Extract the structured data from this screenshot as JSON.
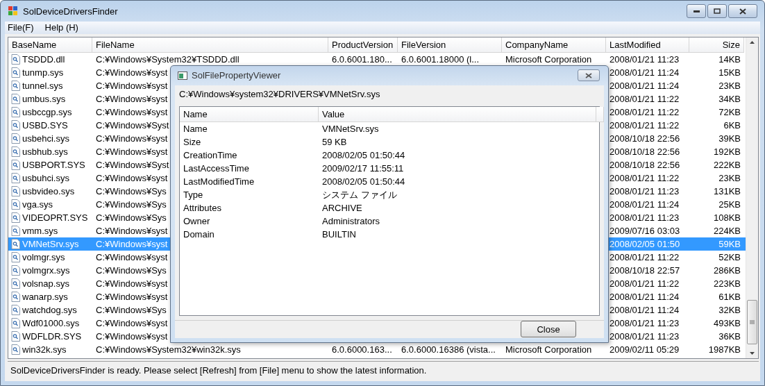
{
  "window": {
    "title": "SolDeviceDriversFinder"
  },
  "menu": [
    "File(F)",
    "Help (H)"
  ],
  "table": {
    "columns": [
      "BaseName",
      "FileName",
      "ProductVersion",
      "FileVersion",
      "CompanyName",
      "LastModified",
      "Size"
    ],
    "rows": [
      {
        "base_name": "TSDDD.dll",
        "file_name": "C:¥Windows¥System32¥TSDDD.dll",
        "product_version": "6.0.6001.180...",
        "file_version": "6.0.6001.18000 (l...",
        "company_name": "Microsoft Corporation",
        "last_modified": "2008/01/21 11:23",
        "size": "14KB",
        "selected": false
      },
      {
        "base_name": "tunmp.sys",
        "file_name": "C:¥Windows¥syst",
        "last_modified": "2008/01/21 11:24",
        "size": "15KB",
        "selected": false
      },
      {
        "base_name": "tunnel.sys",
        "file_name": "C:¥Windows¥syst",
        "last_modified": "2008/01/21 11:24",
        "size": "23KB",
        "selected": false
      },
      {
        "base_name": "umbus.sys",
        "file_name": "C:¥Windows¥syst",
        "last_modified": "2008/01/21 11:22",
        "size": "34KB",
        "selected": false
      },
      {
        "base_name": "usbccgp.sys",
        "file_name": "C:¥Windows¥syst",
        "last_modified": "2008/01/21 11:22",
        "size": "72KB",
        "selected": false
      },
      {
        "base_name": "USBD.SYS",
        "file_name": "C:¥Windows¥Syst",
        "last_modified": "2008/01/21 11:22",
        "size": "6KB",
        "selected": false
      },
      {
        "base_name": "usbehci.sys",
        "file_name": "C:¥Windows¥syst",
        "last_modified": "2008/10/18 22:56",
        "size": "39KB",
        "selected": false
      },
      {
        "base_name": "usbhub.sys",
        "file_name": "C:¥Windows¥syst",
        "last_modified": "2008/10/18 22:56",
        "size": "192KB",
        "selected": false
      },
      {
        "base_name": "USBPORT.SYS",
        "file_name": "C:¥Windows¥Syst",
        "last_modified": "2008/10/18 22:56",
        "size": "222KB",
        "selected": false
      },
      {
        "base_name": "usbuhci.sys",
        "file_name": "C:¥Windows¥syst",
        "last_modified": "2008/01/21 11:22",
        "size": "23KB",
        "selected": false
      },
      {
        "base_name": "usbvideo.sys",
        "file_name": "C:¥Windows¥Sys",
        "last_modified": "2008/01/21 11:23",
        "size": "131KB",
        "selected": false
      },
      {
        "base_name": "vga.sys",
        "file_name": "C:¥Windows¥Sys",
        "last_modified": "2008/01/21 11:24",
        "size": "25KB",
        "selected": false
      },
      {
        "base_name": "VIDEOPRT.SYS",
        "file_name": "C:¥Windows¥Sys",
        "last_modified": "2008/01/21 11:23",
        "size": "108KB",
        "selected": false
      },
      {
        "base_name": "vmm.sys",
        "file_name": "C:¥Windows¥syst",
        "last_modified": "2009/07/16 03:03",
        "size": "224KB",
        "selected": false
      },
      {
        "base_name": "VMNetSrv.sys",
        "file_name": "C:¥Windows¥syst",
        "last_modified": "2008/02/05 01:50",
        "size": "59KB",
        "selected": true
      },
      {
        "base_name": "volmgr.sys",
        "file_name": "C:¥Windows¥syst",
        "last_modified": "2008/01/21 11:22",
        "size": "52KB",
        "selected": false
      },
      {
        "base_name": "volmgrx.sys",
        "file_name": "C:¥Windows¥Sys",
        "last_modified": "2008/10/18 22:57",
        "size": "286KB",
        "selected": false
      },
      {
        "base_name": "volsnap.sys",
        "file_name": "C:¥Windows¥syst",
        "last_modified": "2008/01/21 11:22",
        "size": "223KB",
        "selected": false
      },
      {
        "base_name": "wanarp.sys",
        "file_name": "C:¥Windows¥syst",
        "last_modified": "2008/01/21 11:24",
        "size": "61KB",
        "selected": false
      },
      {
        "base_name": "watchdog.sys",
        "file_name": "C:¥Windows¥Sys",
        "last_modified": "2008/01/21 11:24",
        "size": "32KB",
        "selected": false
      },
      {
        "base_name": "Wdf01000.sys",
        "file_name": "C:¥Windows¥syst",
        "last_modified": "2008/01/21 11:23",
        "size": "493KB",
        "selected": false
      },
      {
        "base_name": "WDFLDR.SYS",
        "file_name": "C:¥Windows¥syst",
        "last_modified": "2008/01/21 11:23",
        "size": "36KB",
        "selected": false
      },
      {
        "base_name": "win32k.sys",
        "file_name": "C:¥Windows¥System32¥win32k.sys",
        "product_version": "6.0.6000.163...",
        "file_version": "6.0.6000.16386 (vista...",
        "company_name": "Microsoft Corporation",
        "last_modified": "2009/02/11 05:29",
        "size": "1987KB",
        "selected": false
      }
    ]
  },
  "dialog": {
    "title": "SolFilePropertyViewer",
    "path": "C:¥Windows¥system32¥DRIVERS¥VMNetSrv.sys",
    "columns": [
      "Name",
      "Value"
    ],
    "rows": [
      {
        "name": "Name",
        "value": "VMNetSrv.sys"
      },
      {
        "name": "Size",
        "value": "59 KB"
      },
      {
        "name": "CreationTime",
        "value": "2008/02/05 01:50:44"
      },
      {
        "name": "LastAccessTime",
        "value": "2009/02/17 11:55:11"
      },
      {
        "name": "LastModifiedTime",
        "value": "2008/02/05 01:50:44"
      },
      {
        "name": "Type",
        "value": "システム ファイル"
      },
      {
        "name": "Attributes",
        "value": "ARCHIVE"
      },
      {
        "name": "Owner",
        "value": "Administrators"
      },
      {
        "name": "Domain",
        "value": "BUILTIN"
      }
    ],
    "button": "Close"
  },
  "status_bar": "SolDeviceDriversFinder is ready. Please select [Refresh] from [File] menu to show the latest information."
}
